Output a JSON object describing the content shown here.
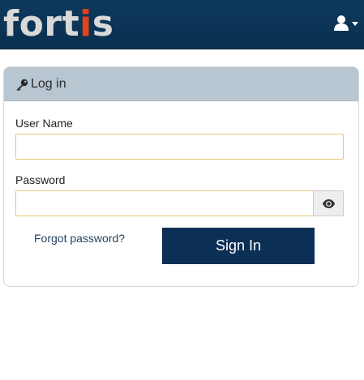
{
  "header": {
    "logo_main": "fort",
    "logo_accent_letter": "i",
    "logo_end": "s",
    "user_icon": "user-icon",
    "menu_caret_icon": "caret-down-icon"
  },
  "login": {
    "title": "Log in",
    "title_icon": "key-icon",
    "username_label": "User Name",
    "username_value": "",
    "password_label": "Password",
    "password_value": "",
    "show_password_icon": "eye-icon",
    "forgot_link": "Forgot password?",
    "signin_label": "Sign In"
  },
  "colors": {
    "topbar": "#0a2f4f",
    "logo_text": "#d9d9d9",
    "logo_accent": "#e0441a",
    "card_header": "#b8c6d1",
    "input_border": "#e6c67a",
    "signin_button": "#0b2f55",
    "link": "#1f3f5e"
  }
}
